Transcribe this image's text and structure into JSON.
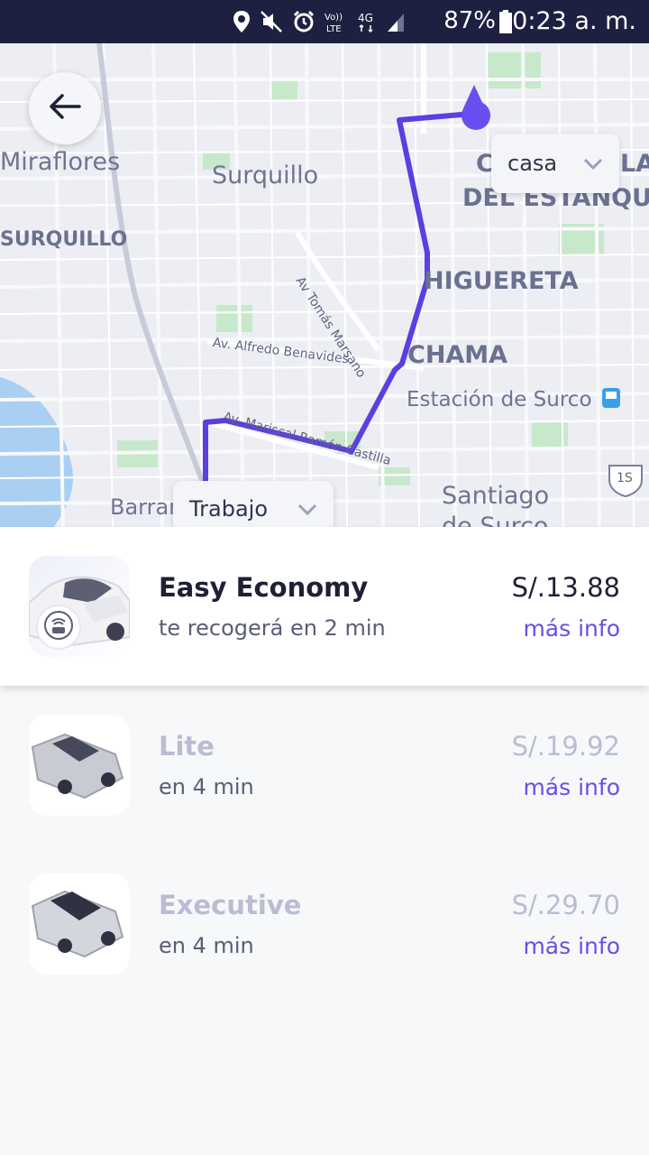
{
  "status_bar": {
    "battery": "87%",
    "time": "10:23 a. m.",
    "network": "4G",
    "volte": "VoLTE",
    "icons": [
      "location-icon",
      "mute-icon",
      "alarm-icon",
      "volte-icon",
      "network-4g-icon",
      "signal-icon",
      "battery-icon"
    ]
  },
  "map": {
    "labels": {
      "miraflores": "Miraflores",
      "surquillo_city": "Surquillo",
      "surquillo_district": "SURQUILLO",
      "higuereta": "HIGUERETA",
      "chama": "CHAMA",
      "estacion": "Estación de Surco",
      "santiago": "Santiago",
      "desurco": "de Surco",
      "estanque": "DEL ESTANQU",
      "la": "LA",
      "c": "C",
      "barranco": "Barran",
      "av_tomas": "Av Tomás Marsano",
      "av_benavides": "Av. Alfredo Benavides",
      "av_castilla": "Av. Mariscal Ramón Castilla",
      "route_1s": "1S"
    },
    "home_chip": "casa",
    "work_chip": "Trabajo",
    "colors": {
      "route": "#5b3fe0",
      "water": "#a9d0f2",
      "park": "#c5e8c8",
      "land": "#eceef3"
    }
  },
  "options": [
    {
      "name": "Easy Economy",
      "eta": "te recogerá en 2 min",
      "price": "S/.13.88",
      "more": "más info",
      "selected": true
    },
    {
      "name": "Lite",
      "eta": "en 4 min",
      "price": "S/.19.92",
      "more": "más info",
      "selected": false
    },
    {
      "name": "Executive",
      "eta": "en 4 min",
      "price": "S/.29.70",
      "more": "más info",
      "selected": false
    }
  ]
}
